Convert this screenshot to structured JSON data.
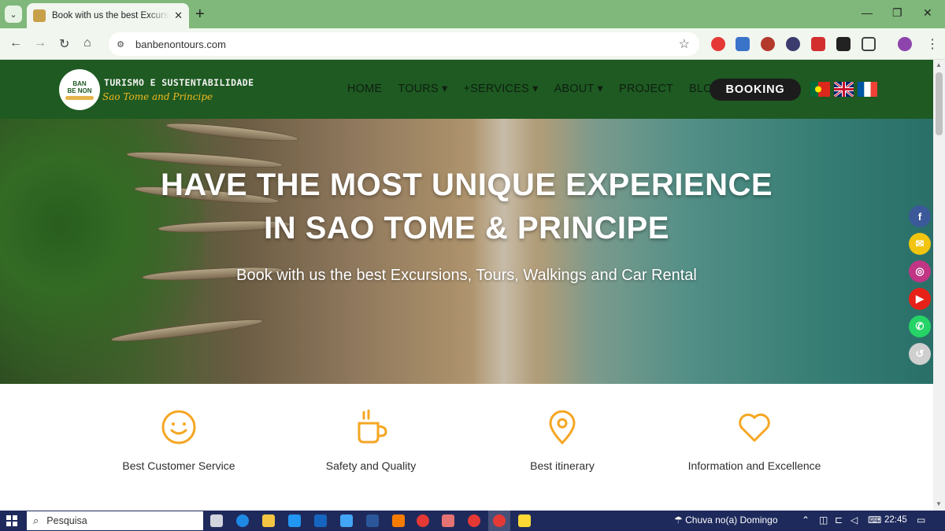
{
  "browser": {
    "tab_title": "Book with us the best Excursions",
    "url": "banbenontours.com",
    "new_tab_label": "+",
    "tab_close": "✕"
  },
  "site": {
    "logo_lines": [
      "BAN",
      "BE NON"
    ],
    "brand_line1": "TURISMO E SUSTENTABILIDADE",
    "brand_line2": "Sao Tome and Principe",
    "nav": {
      "home": "HOME",
      "tours": "TOURS ▾",
      "services": "+SERVICES ▾",
      "about": "ABOUT ▾",
      "project": "PROJECT",
      "blog": "BLOG"
    },
    "booking": "BOOKING",
    "flags": [
      "portugal-flag-icon",
      "uk-flag-icon",
      "france-flag-icon"
    ]
  },
  "hero": {
    "title_line1": "HAVE THE MOST UNIQUE EXPERIENCE",
    "title_line2": "IN SAO TOME & PRINCIPE",
    "subtitle": "Book with us the best Excursions, Tours, Walkings and Car Rental"
  },
  "social": [
    {
      "name": "facebook-icon",
      "glyph": "f",
      "color": "#3b5998"
    },
    {
      "name": "email-icon",
      "glyph": "✉",
      "color": "#f1c40f"
    },
    {
      "name": "instagram-icon",
      "glyph": "◎",
      "color": "#c13584"
    },
    {
      "name": "youtube-icon",
      "glyph": "▶",
      "color": "#e62117"
    },
    {
      "name": "whatsapp-icon",
      "glyph": "✆",
      "color": "#25d366"
    },
    {
      "name": "history-icon",
      "glyph": "↺",
      "color": "#cfcfcf"
    }
  ],
  "features": [
    {
      "icon": "smile-icon",
      "label": "Best Customer Service"
    },
    {
      "icon": "coffee-cup-icon",
      "label": "Safety and Quality"
    },
    {
      "icon": "map-pin-icon",
      "label": "Best itinerary"
    },
    {
      "icon": "heart-icon",
      "label": "Information and Excellence"
    }
  ],
  "taskbar": {
    "search_placeholder": "Pesquisa",
    "weather": "Chuva no(a) Domingo",
    "time": "22:45"
  },
  "colors": {
    "header_green": "#1e5a22",
    "accent_orange": "#f5a623",
    "booking_bg": "#1c1c1c"
  }
}
